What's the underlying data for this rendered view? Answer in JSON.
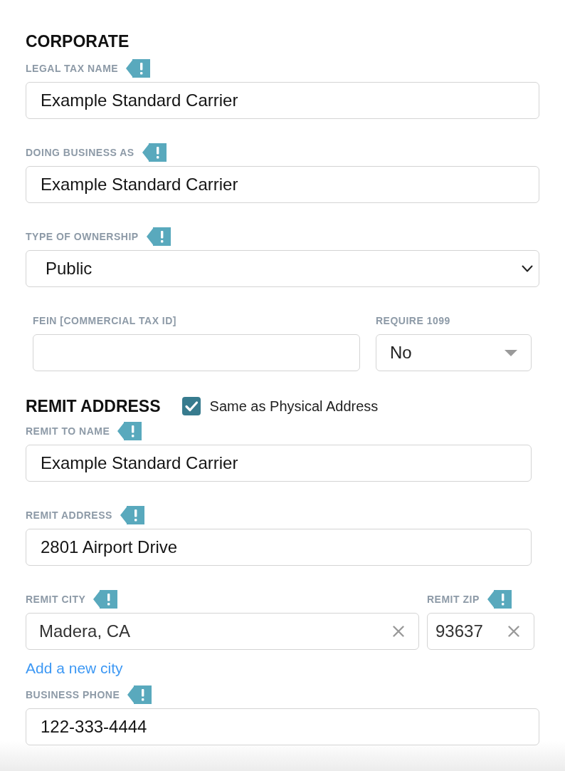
{
  "sections": [
    {
      "heading": "CORPORATE",
      "rows": [
        {
          "fields": [
            {
              "kind": "text",
              "label": "LEGAL TAX NAME",
              "required": true,
              "value": "Example Standard Carrier"
            }
          ]
        },
        {
          "fields": [
            {
              "kind": "text",
              "label": "DOING BUSINESS AS",
              "required": true,
              "value": "Example Standard Carrier"
            }
          ]
        },
        {
          "fields": [
            {
              "kind": "select",
              "label": "TYPE OF OWNERSHIP",
              "required": true,
              "value": "Public"
            }
          ]
        },
        {
          "fields": [
            {
              "kind": "text",
              "label": "FEIN [COMMERCIAL TAX ID]",
              "required": false
            },
            {
              "kind": "dropdown",
              "label": "REQUIRE 1099",
              "required": false,
              "value": "No"
            }
          ]
        }
      ]
    },
    {
      "heading": "REMIT ADDRESS",
      "checkbox": {
        "label": "Same as Physical Address",
        "checked": true
      },
      "rows": [
        {
          "fields": [
            {
              "kind": "text",
              "label": "REMIT TO NAME",
              "required": true,
              "value": "Example Standard Carrier"
            }
          ]
        },
        {
          "fields": [
            {
              "kind": "text",
              "label": "REMIT ADDRESS",
              "required": true,
              "value": "2801 Airport Drive"
            }
          ]
        },
        {
          "fields": [
            {
              "kind": "combo",
              "label": "REMIT CITY",
              "required": true,
              "value": "Madera, CA",
              "link": "Add a new city"
            },
            {
              "kind": "combo",
              "label": "REMIT ZIP",
              "required": true,
              "value": "93637"
            }
          ]
        },
        {
          "fields": [
            {
              "kind": "text",
              "label": "BUSINESS PHONE",
              "required": true,
              "value": "122-333-4444"
            }
          ]
        }
      ]
    }
  ]
}
